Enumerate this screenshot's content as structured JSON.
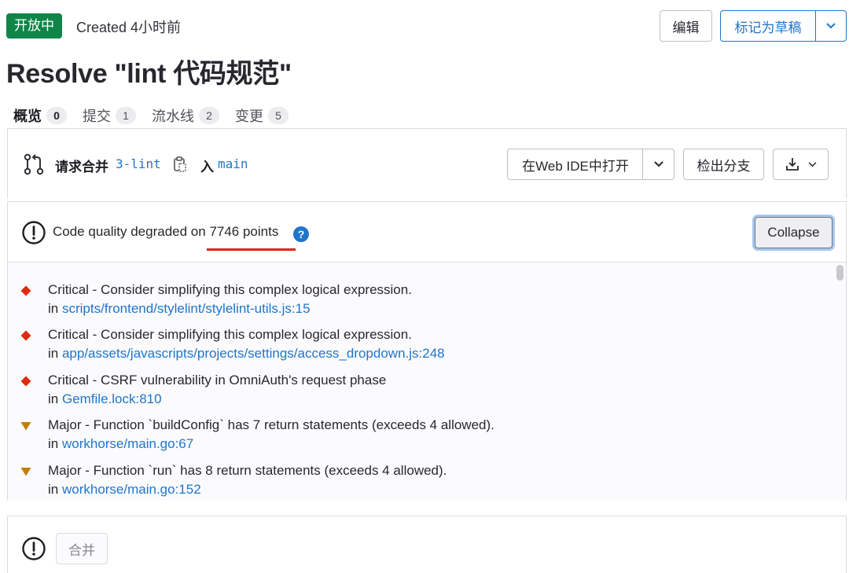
{
  "header": {
    "status": "开放中",
    "created": "Created 4小时前",
    "edit_label": "编辑",
    "draft_label": "标记为草稿",
    "title": "Resolve \"lint 代码规范\""
  },
  "tabs": [
    {
      "label": "概览",
      "count": "0"
    },
    {
      "label": "提交",
      "count": "1"
    },
    {
      "label": "流水线",
      "count": "2"
    },
    {
      "label": "变更",
      "count": "5"
    }
  ],
  "merge_request": {
    "label": "请求合并",
    "source_branch": "3-lint",
    "into_label": "入",
    "target_branch": "main",
    "webide_label": "在Web IDE中打开",
    "checkout_label": "检出分支"
  },
  "code_quality": {
    "summary_prefix": "Code quality degraded on ",
    "summary_value": "7746 points",
    "help": "?",
    "collapse_label": "Collapse",
    "in_label": "in ",
    "issues": [
      {
        "severity": "critical",
        "title": "Critical - Consider simplifying this complex logical expression.",
        "location": "scripts/frontend/stylelint/stylelint-utils.js:15"
      },
      {
        "severity": "critical",
        "title": "Critical - Consider simplifying this complex logical expression.",
        "location": "app/assets/javascripts/projects/settings/access_dropdown.js:248"
      },
      {
        "severity": "critical",
        "title": "Critical - CSRF vulnerability in OmniAuth's request phase",
        "location": "Gemfile.lock:810"
      },
      {
        "severity": "major",
        "title": "Major - Function `buildConfig` has 7 return statements (exceeds 4 allowed).",
        "location": "workhorse/main.go:67"
      },
      {
        "severity": "major",
        "title": "Major - Function `run` has 8 return statements (exceeds 4 allowed).",
        "location": "workhorse/main.go:152"
      }
    ]
  },
  "merge": {
    "merge_label": "合并"
  },
  "colors": {
    "status_green": "#108548",
    "link_blue": "#1f75cb",
    "critical_red": "#dd2b0e",
    "major_orange": "#c17d10",
    "underline_red": "#e0251b"
  },
  "icons": {
    "merge_request": "merge-request-icon",
    "copy": "copy-icon",
    "download": "download-icon",
    "warning": "warning-circle-icon",
    "help": "help-icon",
    "caret": "chevron-down-icon"
  }
}
